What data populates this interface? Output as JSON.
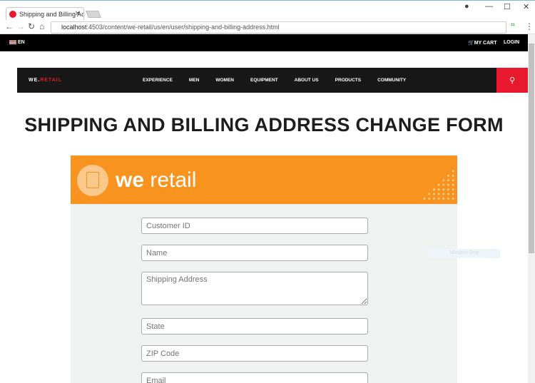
{
  "browser": {
    "tab_title": "Shipping and Billing Addr",
    "url_host": "localhost",
    "url_rest": ":4503/content/we-retail/us/en/user/shipping-and-billing-address.html"
  },
  "topbar": {
    "language": "EN",
    "cart": "MY CART",
    "login": "LOGIN"
  },
  "nav": {
    "logo_a": "WE.",
    "logo_b": "RETAIL",
    "items": [
      "EXPERIENCE",
      "MEN",
      "WOMEN",
      "EQUIPMENT",
      "ABOUT US",
      "PRODUCTS",
      "COMMUNITY"
    ]
  },
  "page": {
    "title": "SHIPPING AND BILLING ADDRESS CHANGE FORM"
  },
  "banner": {
    "brand_a": "we",
    "brand_b": " retail"
  },
  "form": {
    "customer_id": "Customer ID",
    "name": "Name",
    "shipping_address": "Shipping Address",
    "state": "State",
    "zip": "ZIP Code",
    "email": "Email"
  },
  "overlay": "Window Snip",
  "colors": {
    "accent_red": "#e8192c",
    "banner_orange": "#f7931e",
    "nav_bg": "#181818",
    "form_bg": "#f0f1f1"
  }
}
